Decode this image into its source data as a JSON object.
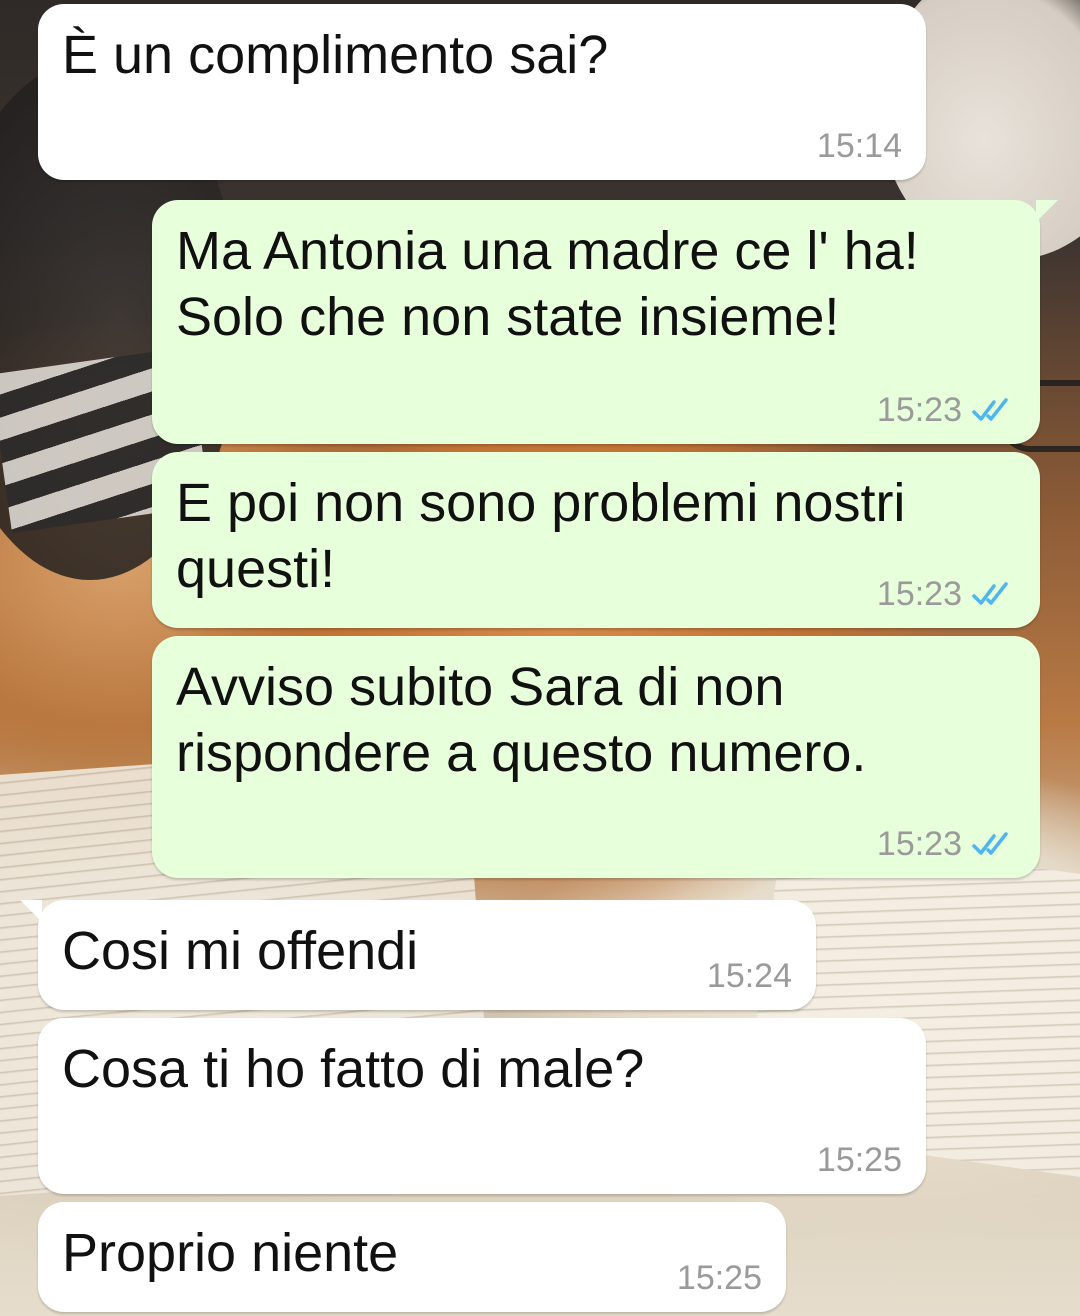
{
  "messages": [
    {
      "direction": "incoming",
      "text": "È un complimento sai?",
      "time": "15:14",
      "read": false
    },
    {
      "direction": "outgoing",
      "text": "Ma Antonia una madre ce l' ha!\nSolo che non state insieme!",
      "time": "15:23",
      "read": true
    },
    {
      "direction": "outgoing",
      "text": "E poi non sono problemi nostri\nquesti!",
      "time": "15:23",
      "read": true
    },
    {
      "direction": "outgoing",
      "text": "Avviso subito Sara di non\nrispondere a questo numero.",
      "time": "15:23",
      "read": true
    },
    {
      "direction": "incoming",
      "text": "Cosi mi offendi",
      "time": "15:24",
      "read": false
    },
    {
      "direction": "incoming",
      "text": "Cosa ti ho fatto di male?",
      "time": "15:25",
      "read": false
    },
    {
      "direction": "incoming",
      "text": "Proprio niente",
      "time": "15:25",
      "read": false
    }
  ],
  "colors": {
    "incoming_bubble": "#ffffff",
    "outgoing_bubble": "#e7ffdb",
    "read_tick": "#4fb6ec",
    "timestamp": "#9a9a9a"
  },
  "icons": {
    "read_receipt": "double-check-icon"
  }
}
